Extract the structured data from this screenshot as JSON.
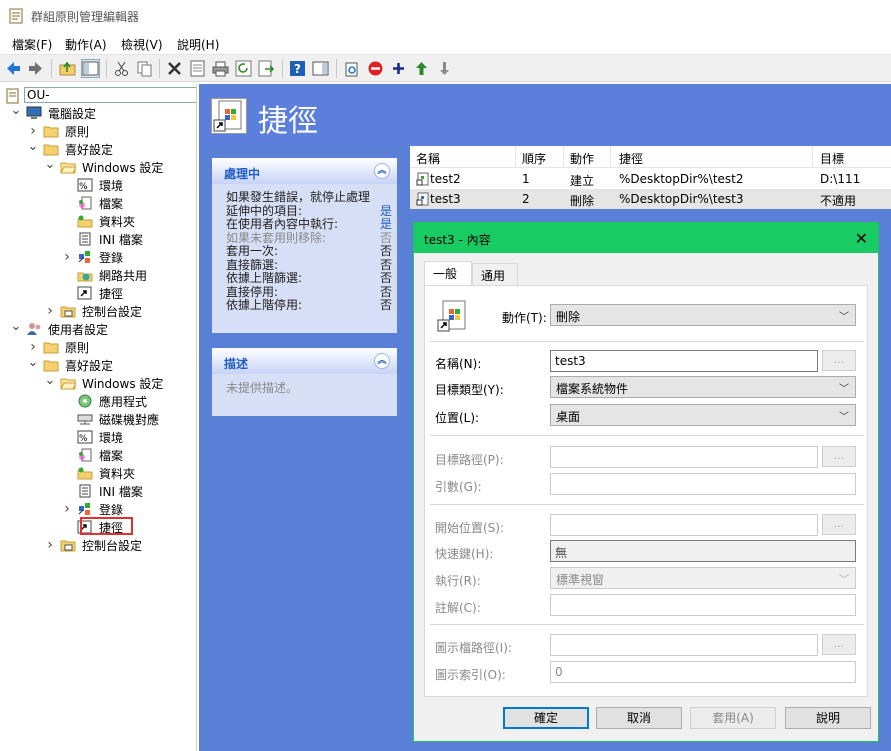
{
  "window": {
    "title": "群組原則管理編輯器"
  },
  "menu": [
    "檔案(F)",
    "動作(A)",
    "檢視(V)",
    "說明(H)"
  ],
  "tree": {
    "root": "OU-",
    "items": [
      {
        "label": "電腦設定",
        "icon": "computer-icon",
        "chev": "down"
      },
      {
        "label": "原則",
        "icon": "folder-icon",
        "chev": "right"
      },
      {
        "label": "喜好設定",
        "icon": "folder-icon",
        "chev": "down"
      },
      {
        "label": "Windows 設定",
        "icon": "folder-open-icon",
        "chev": "down"
      },
      {
        "label": "環境",
        "icon": "environment-icon",
        "chev": ""
      },
      {
        "label": "檔案",
        "icon": "files-icon",
        "chev": ""
      },
      {
        "label": "資料夾",
        "icon": "folders-icon",
        "chev": ""
      },
      {
        "label": "INI 檔案",
        "icon": "ini-file-icon",
        "chev": ""
      },
      {
        "label": "登錄",
        "icon": "registry-icon",
        "chev": "right"
      },
      {
        "label": "網路共用",
        "icon": "network-share-icon",
        "chev": ""
      },
      {
        "label": "捷徑",
        "icon": "shortcut-icon",
        "chev": ""
      },
      {
        "label": "控制台設定",
        "icon": "control-panel-icon",
        "chev": "right"
      },
      {
        "label": "使用者設定",
        "icon": "user-icon",
        "chev": "down"
      },
      {
        "label": "原則",
        "icon": "folder-icon",
        "chev": "right"
      },
      {
        "label": "喜好設定",
        "icon": "folder-icon",
        "chev": "down"
      },
      {
        "label": "Windows 設定",
        "icon": "folder-open-icon",
        "chev": "down"
      },
      {
        "label": "應用程式",
        "icon": "applications-icon",
        "chev": ""
      },
      {
        "label": "磁碟機對應",
        "icon": "drive-map-icon",
        "chev": ""
      },
      {
        "label": "環境",
        "icon": "environment-icon",
        "chev": ""
      },
      {
        "label": "檔案",
        "icon": "files-icon",
        "chev": ""
      },
      {
        "label": "資料夾",
        "icon": "folders-icon",
        "chev": ""
      },
      {
        "label": "INI 檔案",
        "icon": "ini-file-icon",
        "chev": ""
      },
      {
        "label": "登錄",
        "icon": "registry-icon",
        "chev": "right"
      },
      {
        "label": "捷徑",
        "icon": "shortcut-icon",
        "chev": ""
      },
      {
        "label": "控制台設定",
        "icon": "control-panel-icon",
        "chev": "right"
      }
    ]
  },
  "header": {
    "title": "捷徑"
  },
  "processing_panel": {
    "title": "處理中",
    "rows": [
      {
        "k": "如果發生錯誤，就停止處理",
        "v": ""
      },
      {
        "k": "延伸中的項目:",
        "v": "是"
      },
      {
        "k": "在使用者內容中執行:",
        "v": "是"
      },
      {
        "k": "如果未套用則移除:",
        "v": "否"
      },
      {
        "k": "套用一次:",
        "v": "否"
      },
      {
        "k": "直接篩選:",
        "v": "否"
      },
      {
        "k": "依據上階篩選:",
        "v": "否"
      },
      {
        "k": "直接停用:",
        "v": "否"
      },
      {
        "k": "依據上階停用:",
        "v": "否"
      }
    ]
  },
  "description_panel": {
    "title": "描述",
    "text": "未提供描述。"
  },
  "list": {
    "columns": [
      "名稱",
      "順序",
      "動作",
      "捷徑",
      "目標"
    ],
    "rows": [
      {
        "name": "test2",
        "order": "1",
        "action": "建立",
        "shortcut": "%DesktopDir%\\test2",
        "target": "D:\\111"
      },
      {
        "name": "test3",
        "order": "2",
        "action": "刪除",
        "shortcut": "%DesktopDir%\\test3",
        "target": "不適用"
      }
    ]
  },
  "dialog": {
    "title": "test3 - 內容",
    "tabs": [
      "一般",
      "通用"
    ],
    "action_label": "動作(T):",
    "action_value": "刪除",
    "name_label": "名稱(N):",
    "name_value": "test3",
    "target_type_label": "目標類型(Y):",
    "target_type_value": "檔案系統物件",
    "location_label": "位置(L):",
    "location_value": "桌面",
    "target_path_label": "目標路徑(P):",
    "arguments_label": "引數(G):",
    "start_in_label": "開始位置(S):",
    "hotkey_label": "快速鍵(H):",
    "hotkey_value": "無",
    "run_label": "執行(R):",
    "run_value": "標準視窗",
    "comment_label": "註解(C):",
    "icon_path_label": "圖示檔路徑(I):",
    "icon_index_label": "圖示索引(O):",
    "icon_index_value": "0",
    "browse": "...",
    "buttons": {
      "ok": "確定",
      "cancel": "取消",
      "apply": "套用(A)",
      "help": "說明"
    }
  }
}
